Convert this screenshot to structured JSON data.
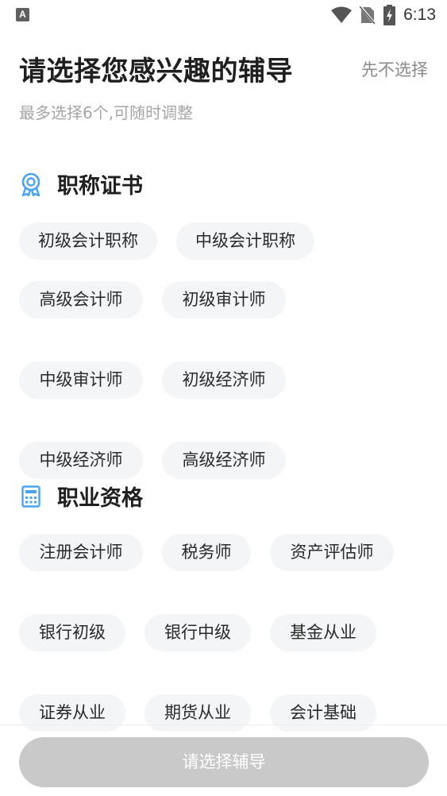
{
  "status_bar": {
    "left_badge": "A",
    "time": "6:13"
  },
  "header": {
    "title": "请选择您感兴趣的辅导",
    "skip_label": "先不选择",
    "subtitle": "最多选择6个,可随时调整"
  },
  "sections": [
    {
      "title": "职称证书",
      "icon": "award-ribbon-icon",
      "items": [
        "初级会计职称",
        "中级会计职称",
        "高级会计师",
        "初级审计师",
        "中级审计师",
        "初级经济师",
        "中级经济师",
        "高级经济师"
      ]
    },
    {
      "title": "职业资格",
      "icon": "calculator-icon",
      "items": [
        "注册会计师",
        "税务师",
        "资产评估师",
        "银行初级",
        "银行中级",
        "基金从业",
        "证券从业",
        "期货从业",
        "会计基础"
      ]
    }
  ],
  "footer": {
    "submit_label": "请选择辅导"
  },
  "colors": {
    "accent": "#4aa3f0",
    "chip_bg": "#f4f5f7",
    "button_disabled": "#c9c9c9"
  }
}
